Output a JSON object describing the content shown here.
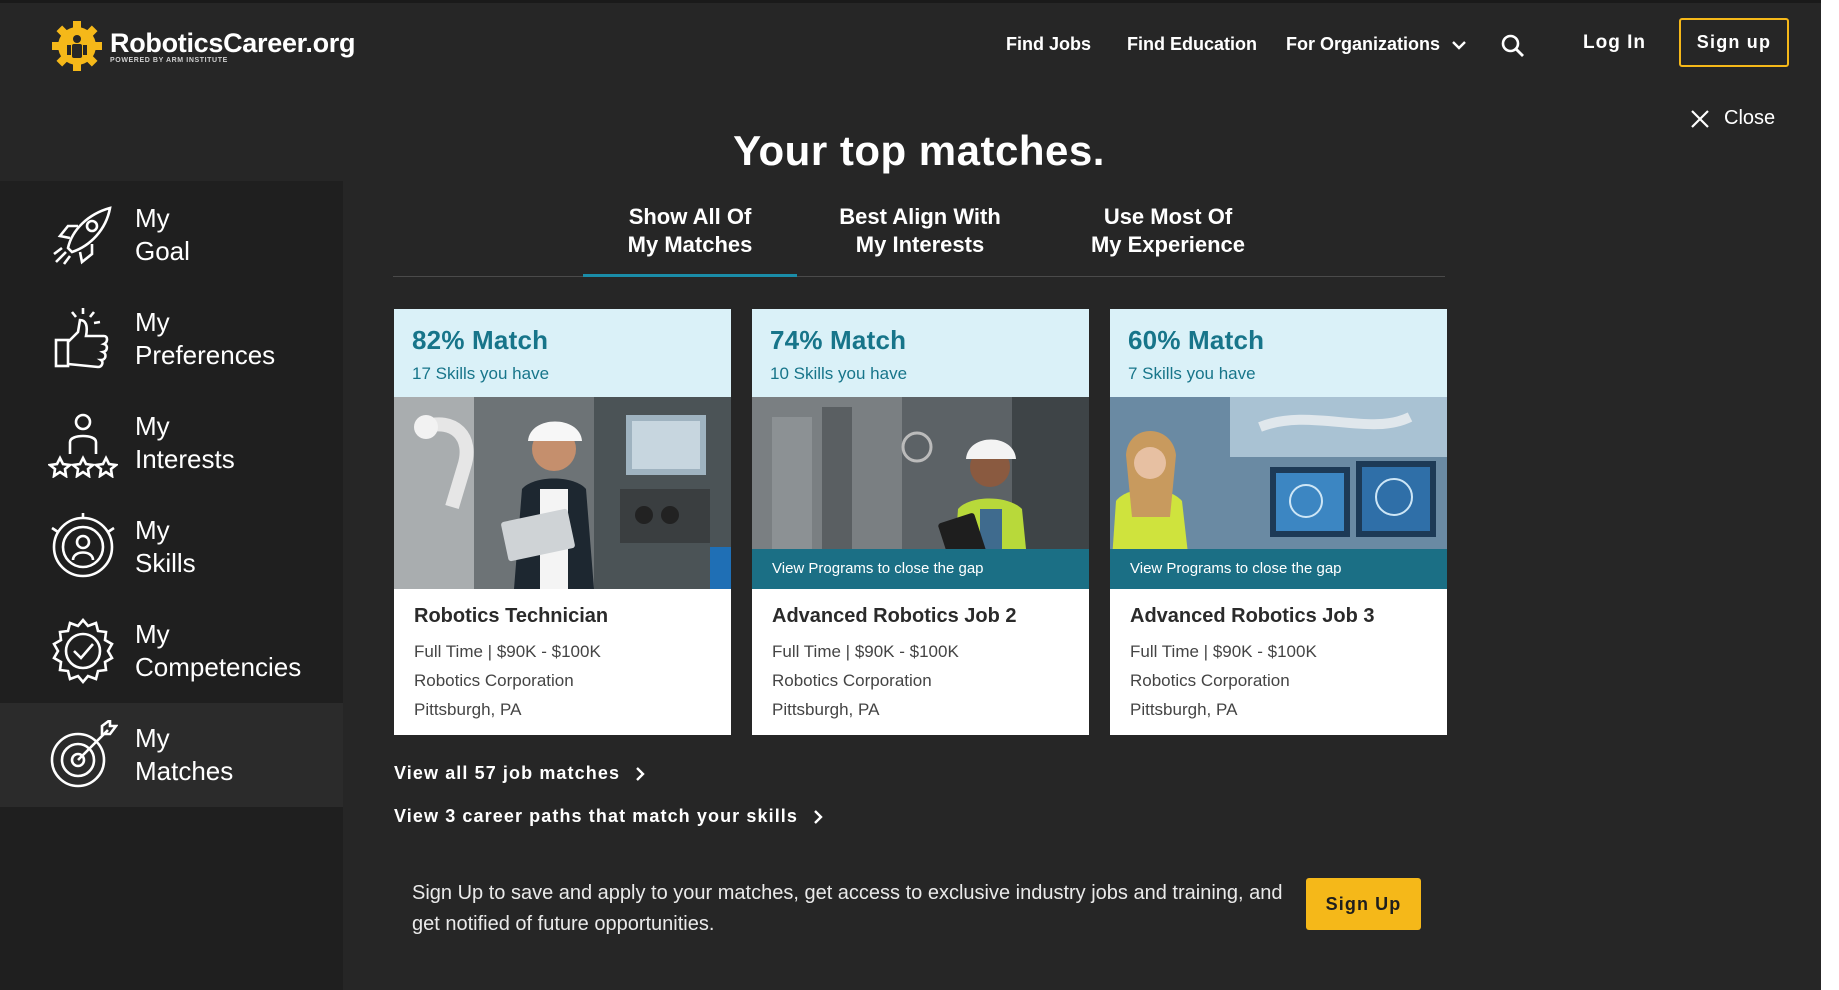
{
  "brand": {
    "name": "RoboticsCareer.org",
    "tagline": "POWERED BY ARM INSTITUTE",
    "accent": "#f5b819",
    "teal": "#17758a"
  },
  "nav": {
    "find_jobs": "Find Jobs",
    "find_education": "Find Education",
    "for_organizations": "For Organizations",
    "log_in": "Log In",
    "sign_up": "Sign up"
  },
  "close_label": "Close",
  "sidebar": {
    "items": [
      {
        "line1": "My",
        "line2": "Goal",
        "icon": "rocket-icon"
      },
      {
        "line1": "My",
        "line2": "Preferences",
        "icon": "thumbs-up-icon"
      },
      {
        "line1": "My",
        "line2": "Interests",
        "icon": "person-stars-icon"
      },
      {
        "line1": "My",
        "line2": "Skills",
        "icon": "skills-target-icon"
      },
      {
        "line1": "My",
        "line2": "Competencies",
        "icon": "gear-check-icon"
      },
      {
        "line1": "My",
        "line2": "Matches",
        "icon": "bullseye-icon"
      }
    ]
  },
  "main": {
    "title": "Your top matches.",
    "tabs": [
      {
        "line1": "Show All Of",
        "line2": "My Matches"
      },
      {
        "line1": "Best Align With",
        "line2": "My Interests"
      },
      {
        "line1": "Use Most Of",
        "line2": "My Experience"
      }
    ],
    "cards": [
      {
        "match": "82% Match",
        "skills": "17 Skills you have",
        "gap_bar": "",
        "title": "Robotics Technician",
        "type_salary": "Full Time | $90K - $100K",
        "company": "Robotics Corporation",
        "location": "Pittsburgh, PA"
      },
      {
        "match": "74% Match",
        "skills": "10 Skills you have",
        "gap_bar": "View Programs to close the gap",
        "title": "Advanced Robotics Job 2",
        "type_salary": "Full Time | $90K - $100K",
        "company": "Robotics Corporation",
        "location": "Pittsburgh, PA"
      },
      {
        "match": "60% Match",
        "skills": "7 Skills you have",
        "gap_bar": "View Programs to close the gap",
        "title": "Advanced Robotics Job 3",
        "type_salary": "Full Time | $90K - $100K",
        "company": "Robotics Corporation",
        "location": "Pittsburgh, PA"
      }
    ],
    "links": {
      "view_all_jobs": "View all 57 job matches",
      "view_career_paths": "View 3 career paths that match your skills"
    },
    "promo": {
      "text": "Sign Up to save and apply to your matches, get access to exclusive industry jobs and training, and get notified of future opportunities.",
      "button": "Sign Up"
    }
  }
}
